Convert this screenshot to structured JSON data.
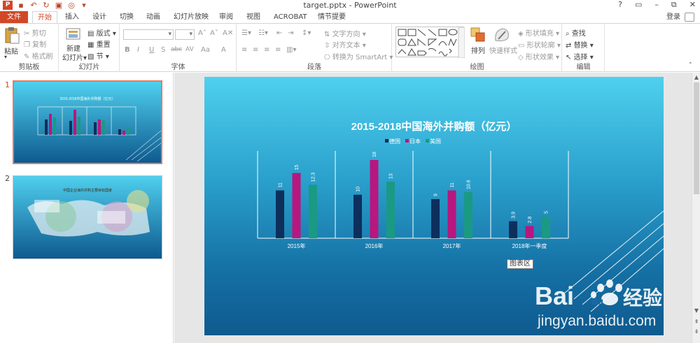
{
  "window": {
    "title": "target.pptx - PowerPoint",
    "controls": [
      "?",
      "▭",
      "–",
      "⧉",
      "✕"
    ]
  },
  "tabs": [
    {
      "label": "文件"
    },
    {
      "label": "开始"
    },
    {
      "label": "插入"
    },
    {
      "label": "设计"
    },
    {
      "label": "切换"
    },
    {
      "label": "动画"
    },
    {
      "label": "幻灯片放映"
    },
    {
      "label": "审阅"
    },
    {
      "label": "视图"
    },
    {
      "label": "ACROBAT"
    },
    {
      "label": "情节提要"
    }
  ],
  "login": "登录",
  "ribbon": {
    "clipboard": {
      "paste": "粘贴",
      "cut": "剪切",
      "copy": "复制",
      "format_painter": "格式刷",
      "label": "剪贴板"
    },
    "slides": {
      "new_slide": "新建",
      "new_slide2": "幻灯片",
      "layout": "版式",
      "reset": "重置",
      "section": "节",
      "label": "幻灯片"
    },
    "font": {
      "label": "字体",
      "buttons": [
        "B",
        "I",
        "U",
        "S",
        "abc",
        "AV",
        "Aa",
        "A"
      ]
    },
    "paragraph": {
      "text_direction": "文字方向",
      "align_text": "对齐文本",
      "smartart": "转换为 SmartArt",
      "label": "段落"
    },
    "drawing": {
      "arrange": "排列",
      "quick_styles": "快速样式",
      "shape_fill": "形状填充",
      "shape_outline": "形状轮廓",
      "shape_effects": "形状效果",
      "label": "绘图"
    },
    "editing": {
      "find": "查找",
      "replace": "替换",
      "select": "选择",
      "label": "编辑"
    }
  },
  "slides_panel": {
    "items": [
      {
        "number": "1",
        "thumb_title": "2015-2018中国海外并购额（亿元）"
      },
      {
        "number": "2",
        "thumb_title": "中国企业海外并购主要目标国家"
      }
    ]
  },
  "chart_tooltip": "图表区",
  "watermark": {
    "brand": "Bai",
    "brand2": "du",
    "cn": "经验",
    "url": "jingyan.baidu.com"
  },
  "chart_data": {
    "type": "bar",
    "title": "2015-2018中国海外并购额（亿元）",
    "categories": [
      "2015年",
      "2016年",
      "2017年",
      "2018年一季度"
    ],
    "series": [
      {
        "name": "德国",
        "values": [
          11,
          10,
          9,
          3.9
        ],
        "color": "#0d2f5c"
      },
      {
        "name": "日本",
        "values": [
          15,
          18,
          11,
          2.8
        ],
        "color": "#b7177f"
      },
      {
        "name": "美国",
        "values": [
          12.3,
          13,
          10.6,
          5
        ],
        "color": "#1a9a83"
      }
    ],
    "data_labels": [
      [
        "11",
        "10",
        "9",
        "3.9"
      ],
      [
        "15",
        "18",
        "11",
        "2.8"
      ],
      [
        "12.3",
        "13",
        "10.6",
        "5"
      ]
    ],
    "ylim": [
      0,
      20
    ],
    "legend": "top",
    "grid": false
  }
}
